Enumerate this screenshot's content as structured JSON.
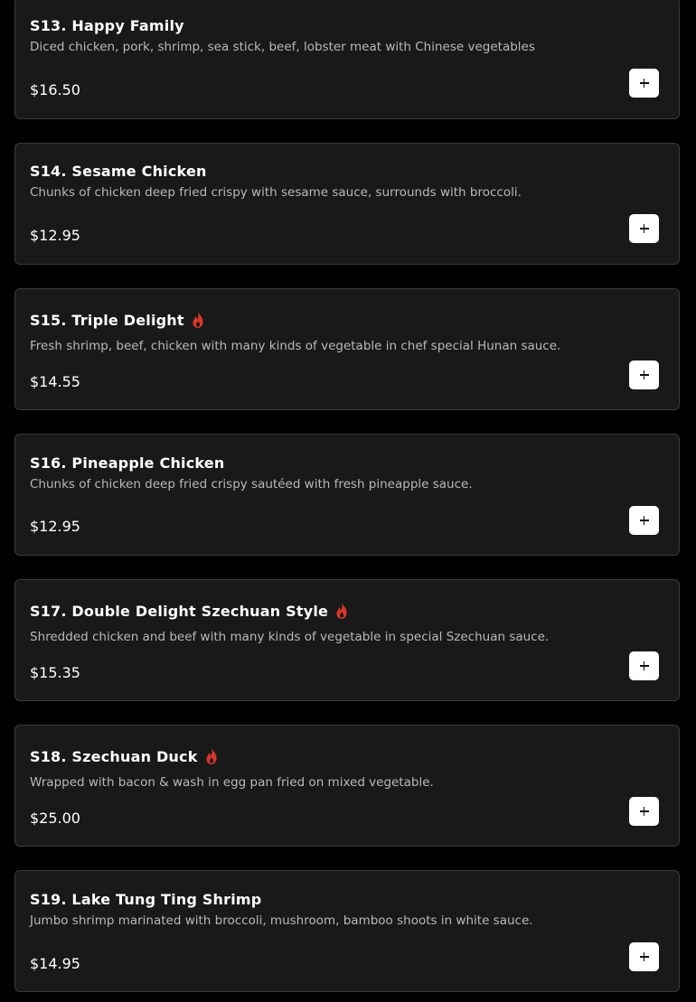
{
  "colors": {
    "page_background": "#000000",
    "card_background": "#191919",
    "card_border": "#3a3a3a",
    "title_text": "#ffffff",
    "description_text": "#b9b9b9",
    "add_button": "#ffffff",
    "spicy_icon": "#d9372b"
  },
  "menu_items": [
    {
      "title": "S13. Happy Family",
      "description": "Diced chicken, pork, shrimp, sea stick, beef, lobster meat with Chinese vegetables",
      "price": "$16.50",
      "spicy": false,
      "add_icon": "plus-icon"
    },
    {
      "title": "S14. Sesame Chicken",
      "description": "Chunks of chicken deep fried crispy with sesame sauce, surrounds with broccoli.",
      "price": "$12.95",
      "spicy": false,
      "add_icon": "plus-icon"
    },
    {
      "title": "S15. Triple Delight",
      "description": "Fresh shrimp, beef, chicken with many kinds of vegetable in chef special Hunan sauce.",
      "price": "$14.55",
      "spicy": true,
      "spicy_icon": "flame-icon",
      "add_icon": "plus-icon"
    },
    {
      "title": "S16. Pineapple Chicken",
      "description": "Chunks of chicken deep fried crispy sautéed with fresh pineapple sauce.",
      "price": "$12.95",
      "spicy": false,
      "add_icon": "plus-icon"
    },
    {
      "title": "S17. Double Delight Szechuan Style",
      "description": "Shredded chicken and beef with many kinds of vegetable in special Szechuan sauce.",
      "price": "$15.35",
      "spicy": true,
      "spicy_icon": "flame-icon",
      "add_icon": "plus-icon"
    },
    {
      "title": "S18. Szechuan Duck",
      "description": "Wrapped with bacon & wash in egg pan fried on mixed vegetable.",
      "price": "$25.00",
      "spicy": true,
      "spicy_icon": "flame-icon",
      "add_icon": "plus-icon"
    },
    {
      "title": "S19. Lake Tung Ting Shrimp",
      "description": "Jumbo shrimp marinated with broccoli, mushroom, bamboo shoots in white sauce.",
      "price": "$14.95",
      "spicy": false,
      "add_icon": "plus-icon"
    }
  ]
}
